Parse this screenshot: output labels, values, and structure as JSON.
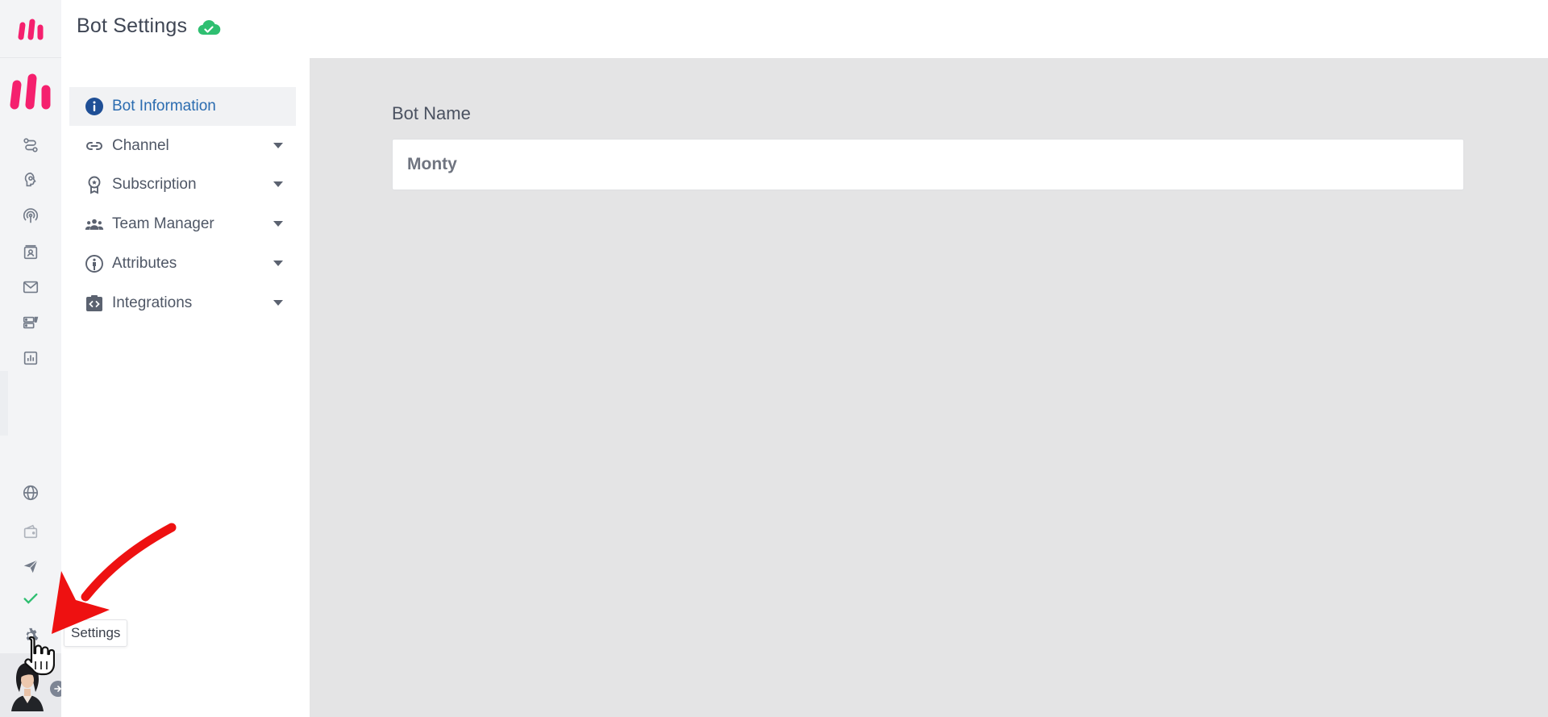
{
  "header": {
    "title": "Bot Settings",
    "status_icon": "cloud-check-icon",
    "status_color": "#2fbf71"
  },
  "rail": {
    "logo_color": "#f5206e",
    "icons": [
      "flow-icon",
      "brain-icon",
      "broadcast-icon",
      "contacts-icon",
      "mail-icon",
      "storage-icon",
      "analytics-icon",
      "globe-icon",
      "wallet-icon",
      "send-icon",
      "check-icon",
      "gear-icon"
    ],
    "check_color": "#2fbf71"
  },
  "settings_nav": {
    "items": [
      {
        "label": "Bot Information",
        "icon": "info-icon",
        "active": true
      },
      {
        "label": "Channel",
        "icon": "link-icon"
      },
      {
        "label": "Subscription",
        "icon": "award-icon"
      },
      {
        "label": "Team Manager",
        "icon": "users-icon"
      },
      {
        "label": "Attributes",
        "icon": "person-icon"
      },
      {
        "label": "Integrations",
        "icon": "code-icon"
      }
    ],
    "active_color": "#2b6cb0"
  },
  "main": {
    "field_label": "Bot Name",
    "field_value": "Monty"
  },
  "tooltip": {
    "text": "Settings"
  },
  "annotation": {
    "arrow_color": "#ee1111"
  }
}
